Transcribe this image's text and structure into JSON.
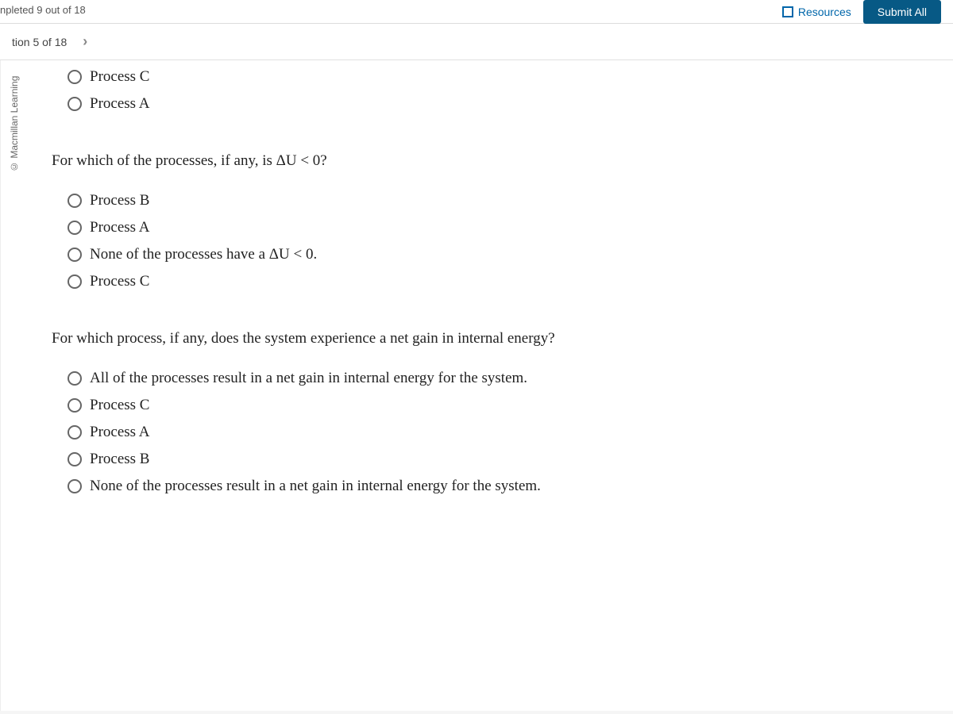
{
  "topBar": {
    "completedText": "npleted 9 out of 18",
    "resourcesLabel": "Resources",
    "submitAllLabel": "Submit All"
  },
  "questionNav": {
    "label": "tion 5 of 18",
    "nextArrow": "›"
  },
  "sidebar": {
    "copyright": "© Macmillan Learning"
  },
  "group1": {
    "options": [
      {
        "label": "Process C"
      },
      {
        "label": "Process A"
      }
    ]
  },
  "question2": {
    "prompt": "For which of the processes, if any, is ΔU < 0?",
    "options": [
      {
        "label": "Process B"
      },
      {
        "label": "Process A"
      },
      {
        "label": "None of the processes have a ΔU < 0."
      },
      {
        "label": "Process C"
      }
    ]
  },
  "question3": {
    "prompt": "For which process, if any, does the system experience a net gain in internal energy?",
    "options": [
      {
        "label": "All of the processes result in a net gain in internal energy for the system."
      },
      {
        "label": "Process C"
      },
      {
        "label": "Process A"
      },
      {
        "label": "Process B"
      },
      {
        "label": "None of the processes result in a net gain in internal energy for the system."
      }
    ]
  }
}
